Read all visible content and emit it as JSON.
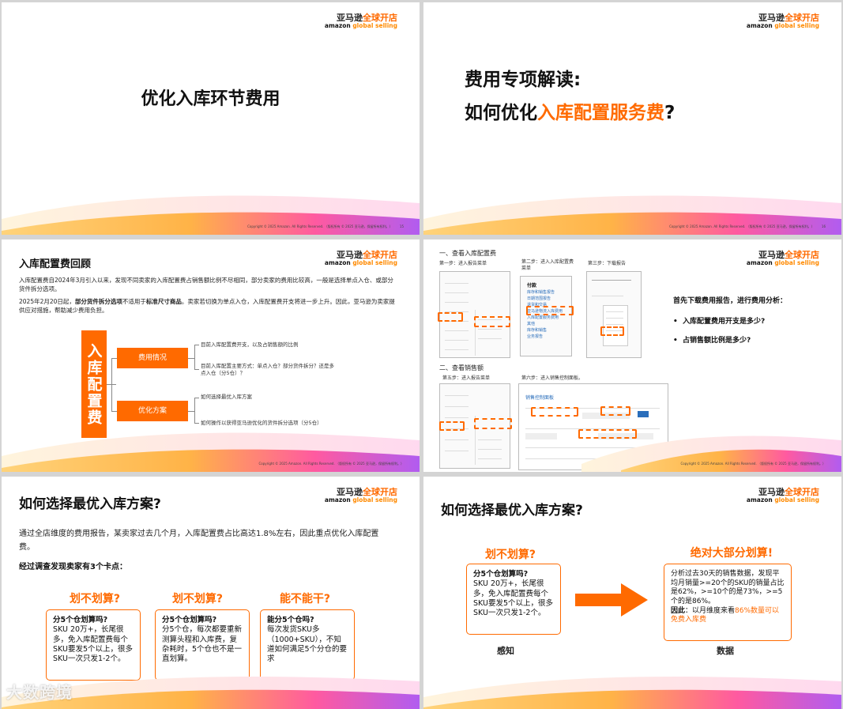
{
  "logo": {
    "cn_a": "亚马逊",
    "cn_b": "全球开店",
    "en_a": "amazon",
    "en_b": "global selling"
  },
  "copyright": "Copyright © 2025 Amazon. All Rights Reserved. （版权所有 © 2025 亚马逊，保留所有权利。）",
  "slide1": {
    "title": "优化入库环节费用",
    "page": "15"
  },
  "slide2": {
    "line1": "费用专项解读:",
    "line2_a": "如何优化",
    "line2_b": "入库配置服务费",
    "line2_c": "?",
    "page": "16"
  },
  "slide3": {
    "title": "入库配置费回顾",
    "para1": "入库配置费自2024年3月引入以来，发现不同卖家的入库配置费占销售额比例不尽相同，部分卖家的费用比较高，一般是选择单点入仓、或部分货件拆分选项。",
    "para2_a": "2025年2月20日起，",
    "para2_b": "部分货件拆分选项",
    "para2_c": "不适用于",
    "para2_d": "标准尺寸商品",
    "para2_e": "。卖家若切换为单点入仓，入库配置费开支将进一步上升。因此，亚马逊为卖家提供应对措施，帮助减少费用负担。",
    "vertical": "入库配置费",
    "box1": "费用情况",
    "box2": "优化方案",
    "item1": "目前入库配置费开支，以及占销售额的比例",
    "item2": "目前入库配置主要方式：单点入仓？部分货件拆分？还是多点入仓（分5仓）？",
    "item3": "如何选择最优入库方案",
    "item4": "如何操作以获得亚马逊优化的货件拆分选项（分5仓）"
  },
  "slide4": {
    "sec1": "一、查看入库配置费",
    "step1": "第一步：进入报告菜单",
    "step2": "第二步：进入入库配置费菜单",
    "step3": "第三步：下载报告",
    "sec2": "二、查看销售额",
    "step5": "第五步：进入报告菜单",
    "step6": "第六步：进入销售控制面板。",
    "menu2": [
      "付款",
      "库存和销售报告",
      "日期范围报告",
      "退货和交易",
      "亚马逊物流入库费用",
      "入库配置服务费用",
      "其他",
      "库存和销售",
      "业务报告"
    ],
    "sales_panel": "销售控制面板",
    "intro": "首先下载费用报告，进行费用分析：",
    "q1": "入库配置费用开支是多少?",
    "q2": "占销售额比例是多少?"
  },
  "slide5": {
    "title": "如何选择最优入库方案?",
    "intro": "通过全店维度的费用报告，某卖家过去几个月，入库配置费占比高达1.8%左右，因此重点优化入库配置费。",
    "sub": "经过调查发现卖家有3个卡点：",
    "h1": "划不划算?",
    "h2": "划不划算?",
    "h3": "能不能干?",
    "c1_title": "分5个仓划算吗?",
    "c1_body": "SKU 20万+，长尾很多，免入库配置费每个SKU要发5个以上，很多SKU一次只发1-2个。",
    "c2_title": "分5个仓划算吗?",
    "c2_body": "分5个仓，每次都要重新测算头程和入库费，复杂耗时，5个仓也不是一直划算。",
    "c3_title": "能分5个仓吗?",
    "c3_body": "每次发货SKU多（1000+SKU），不知道如何满足5个分仓的要求"
  },
  "slide6": {
    "title": "如何选择最优入库方案?",
    "h_left": "划不划算?",
    "h_right": "绝对大部分划算!",
    "left_title": "分5个仓划算吗?",
    "left_body": "SKU 20万+，长尾很多，免入库配置费每个SKU要发5个以上，很多SKU一次只发1-2个。",
    "right_body": "分析过去30天的销售数据，发现平均月销量>=20个的SKU的销量占比是62%，>=10个的是73%，>=5 个的是86%。",
    "right_conc_a": "因此",
    "right_conc_b": "：以月维度来看",
    "right_conc_c": "86%数量可以免费入库费",
    "cap_left": "感知",
    "cap_right": "数据"
  },
  "watermark": "大数跨境",
  "colors": {
    "accent": "#ff6a00"
  }
}
